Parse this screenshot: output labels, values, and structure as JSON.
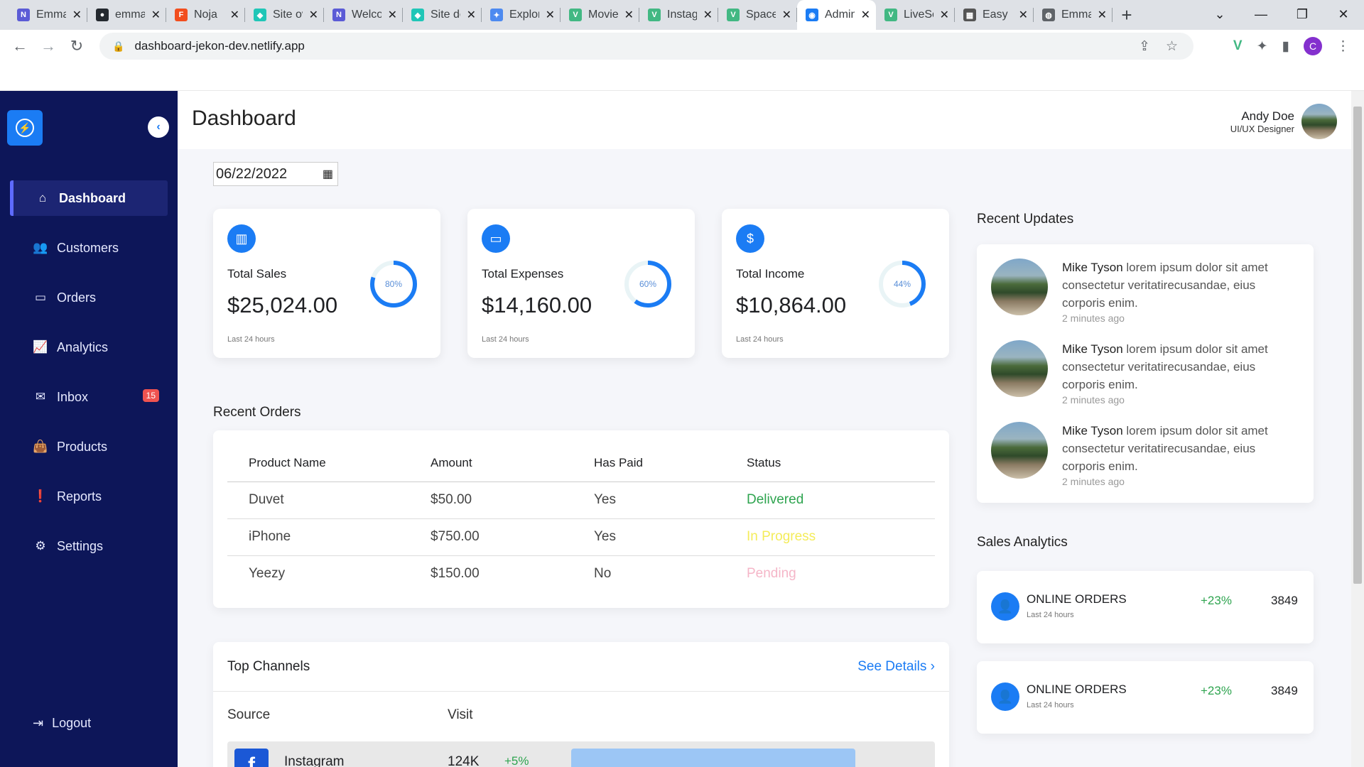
{
  "browser": {
    "tabs": [
      {
        "title": "Emmanuel",
        "icon": "notion-icon",
        "color": "#5b5bd6"
      },
      {
        "title": "emmanuel",
        "icon": "github-icon",
        "color": "#24292f"
      },
      {
        "title": "Noja",
        "icon": "figma-icon",
        "color": "#f24e1e"
      },
      {
        "title": "Site overview",
        "icon": "netlify-icon",
        "color": "#20c6b7"
      },
      {
        "title": "Welcome",
        "icon": "notion-icon",
        "color": "#5b5bd6"
      },
      {
        "title": "Site deploys",
        "icon": "netlify-icon",
        "color": "#20c6b7"
      },
      {
        "title": "Explore",
        "icon": "explore-icon",
        "color": "#4d8af0"
      },
      {
        "title": "Movies",
        "icon": "vue-icon",
        "color": "#42b883"
      },
      {
        "title": "Instagram",
        "icon": "vue-icon",
        "color": "#42b883"
      },
      {
        "title": "Space",
        "icon": "vue-icon",
        "color": "#42b883"
      },
      {
        "title": "Admin",
        "icon": "admin-icon",
        "color": "#1b7cf4",
        "active": true
      },
      {
        "title": "LiveSearch",
        "icon": "vue-icon",
        "color": "#42b883"
      },
      {
        "title": "Easy",
        "icon": "easy-icon",
        "color": "#555555"
      },
      {
        "title": "Emmanuel",
        "icon": "globe-icon",
        "color": "#5f6368"
      }
    ],
    "url": "dashboard-jekon-dev.netlify.app",
    "profile_initial": "C"
  },
  "sidebar": {
    "items": [
      {
        "label": "Dashboard",
        "icon": "home-icon",
        "active": true
      },
      {
        "label": "Customers",
        "icon": "users-icon"
      },
      {
        "label": "Orders",
        "icon": "credit-card-icon"
      },
      {
        "label": "Analytics",
        "icon": "chart-line-icon"
      },
      {
        "label": "Inbox",
        "icon": "envelope-icon",
        "badge": "15"
      },
      {
        "label": "Products",
        "icon": "shopping-bag-icon"
      },
      {
        "label": "Reports",
        "icon": "exclamation-icon"
      },
      {
        "label": "Settings",
        "icon": "gear-icon"
      }
    ],
    "logout": "Logout"
  },
  "header": {
    "title": "Dashboard",
    "user_name": "Andy Doe",
    "user_role": "UI/UX Designer"
  },
  "date": "06/22/2022",
  "cards": [
    {
      "label": "Total Sales",
      "value": "$25,024.00",
      "sub": "Last 24 hours",
      "percent_text": "80%",
      "percent": 80,
      "icon": "bar-chart-icon"
    },
    {
      "label": "Total Expenses",
      "value": "$14,160.00",
      "sub": "Last 24 hours",
      "percent_text": "60%",
      "percent": 60,
      "icon": "credit-card-icon"
    },
    {
      "label": "Total Income",
      "value": "$10,864.00",
      "sub": "Last 24 hours",
      "percent_text": "44%",
      "percent": 44,
      "icon": "money-icon"
    }
  ],
  "recent_orders": {
    "title": "Recent Orders",
    "columns": [
      "Product Name",
      "Amount",
      "Has Paid",
      "Status"
    ],
    "rows": [
      {
        "product": "Duvet",
        "amount": "$50.00",
        "paid": "Yes",
        "status": "Delivered",
        "status_color": "#2ea44f"
      },
      {
        "product": "iPhone",
        "amount": "$750.00",
        "paid": "Yes",
        "status": "In Progress",
        "status_color": "#f4ec5a"
      },
      {
        "product": "Yeezy",
        "amount": "$150.00",
        "paid": "No",
        "status": "Pending",
        "status_color": "#f5b6c8"
      }
    ]
  },
  "top_channels": {
    "title": "Top Channels",
    "see_details": "See Details",
    "columns": [
      "Source",
      "Visit"
    ],
    "rows": [
      {
        "name": "Instagram",
        "visits": "124K",
        "change": "+5%",
        "share": 0.4
      }
    ]
  },
  "recent_updates": {
    "title": "Recent Updates",
    "items": [
      {
        "name": "Mike Tyson",
        "text": " lorem ipsum dolor sit amet consectetur veritatirecusandae, eius corporis enim.",
        "time": "2 minutes ago"
      },
      {
        "name": "Mike Tyson",
        "text": " lorem ipsum dolor sit amet consectetur veritatirecusandae, eius corporis enim.",
        "time": "2 minutes ago"
      },
      {
        "name": "Mike Tyson",
        "text": " lorem ipsum dolor sit amet consectetur veritatirecusandae, eius corporis enim.",
        "time": "2 minutes ago"
      }
    ]
  },
  "sales_analytics": {
    "title": "Sales Analytics",
    "items": [
      {
        "label": "ONLINE ORDERS",
        "sub": "Last 24 hours",
        "change": "+23%",
        "value": "3849"
      },
      {
        "label": "ONLINE ORDERS",
        "sub": "Last 24 hours",
        "change": "+23%",
        "value": "3849"
      }
    ]
  },
  "colors": {
    "accent": "#1b7cf4",
    "sidebar_bg": "#0d1659",
    "positive": "#2ea44f"
  }
}
